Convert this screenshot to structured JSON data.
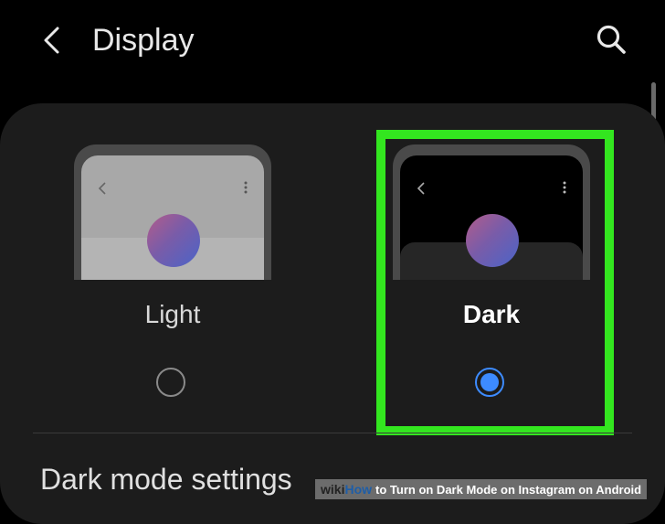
{
  "header": {
    "title": "Display"
  },
  "themes": {
    "light": {
      "label": "Light",
      "selected": false
    },
    "dark": {
      "label": "Dark",
      "selected": true
    }
  },
  "section": {
    "title": "Dark mode settings"
  },
  "watermark": {
    "wiki": "wiki",
    "how": "How",
    "text": "to Turn on Dark Mode on Instagram on Android"
  },
  "colors": {
    "highlight": "#33e61f",
    "radio_selected": "#3d8bff",
    "panel": "#1c1c1c",
    "background": "#000000"
  },
  "icons": {
    "back": "chevron-left-icon",
    "search": "search-icon",
    "menu": "more-vertical-icon"
  }
}
